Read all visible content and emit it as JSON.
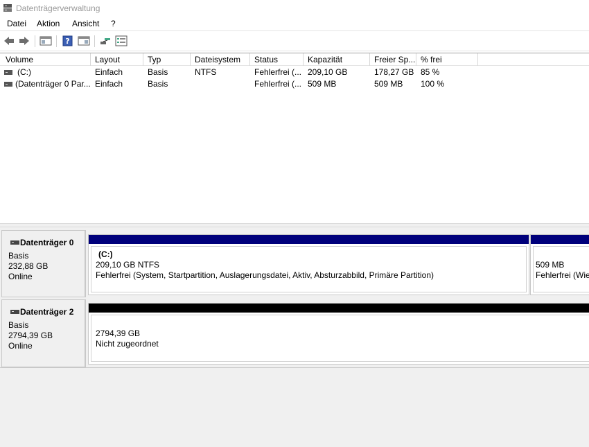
{
  "window": {
    "title": "Datenträgerverwaltung"
  },
  "menu": [
    "Datei",
    "Aktion",
    "Ansicht",
    "?"
  ],
  "toolbar": {
    "icons": [
      "back-arrow-icon",
      "forward-arrow-icon",
      "console-tree-icon",
      "help-icon",
      "properties-icon",
      "connect-icon",
      "list-view-icon"
    ]
  },
  "volume_list": {
    "columns": [
      "Volume",
      "Layout",
      "Typ",
      "Dateisystem",
      "Status",
      "Kapazität",
      "Freier Sp...",
      "% frei"
    ],
    "rows": [
      {
        "volume": "(C:)",
        "layout": "Einfach",
        "typ": "Basis",
        "dateisystem": "NTFS",
        "status": "Fehlerfrei (...",
        "kapazitaet": "209,10 GB",
        "frei": "178,27 GB",
        "prozent": "85 %"
      },
      {
        "volume": "(Datenträger 0 Par...",
        "layout": "Einfach",
        "typ": "Basis",
        "dateisystem": "",
        "status": "Fehlerfrei (...",
        "kapazitaet": "509 MB",
        "frei": "509 MB",
        "prozent": "100 %"
      }
    ]
  },
  "disks": [
    {
      "name": "Datenträger 0",
      "type": "Basis",
      "size": "232,88 GB",
      "state": "Online",
      "partitions": [
        {
          "label": "(C:)",
          "size_fs": "209,10 GB NTFS",
          "status": "Fehlerfrei (System, Startpartition, Auslagerungsdatei, Aktiv, Absturzabbild, Primäre Partition)",
          "bar_color": "#00007b"
        },
        {
          "label": "",
          "size_fs": "509 MB",
          "status": "Fehlerfrei (Wie",
          "bar_color": "#00007b"
        }
      ]
    },
    {
      "name": "Datenträger 2",
      "type": "Basis",
      "size": "2794,39 GB",
      "state": "Online",
      "partitions": [
        {
          "label": "",
          "size_fs": "2794,39 GB",
          "status": "Nicht zugeordnet",
          "bar_color": "#000000"
        }
      ]
    }
  ]
}
